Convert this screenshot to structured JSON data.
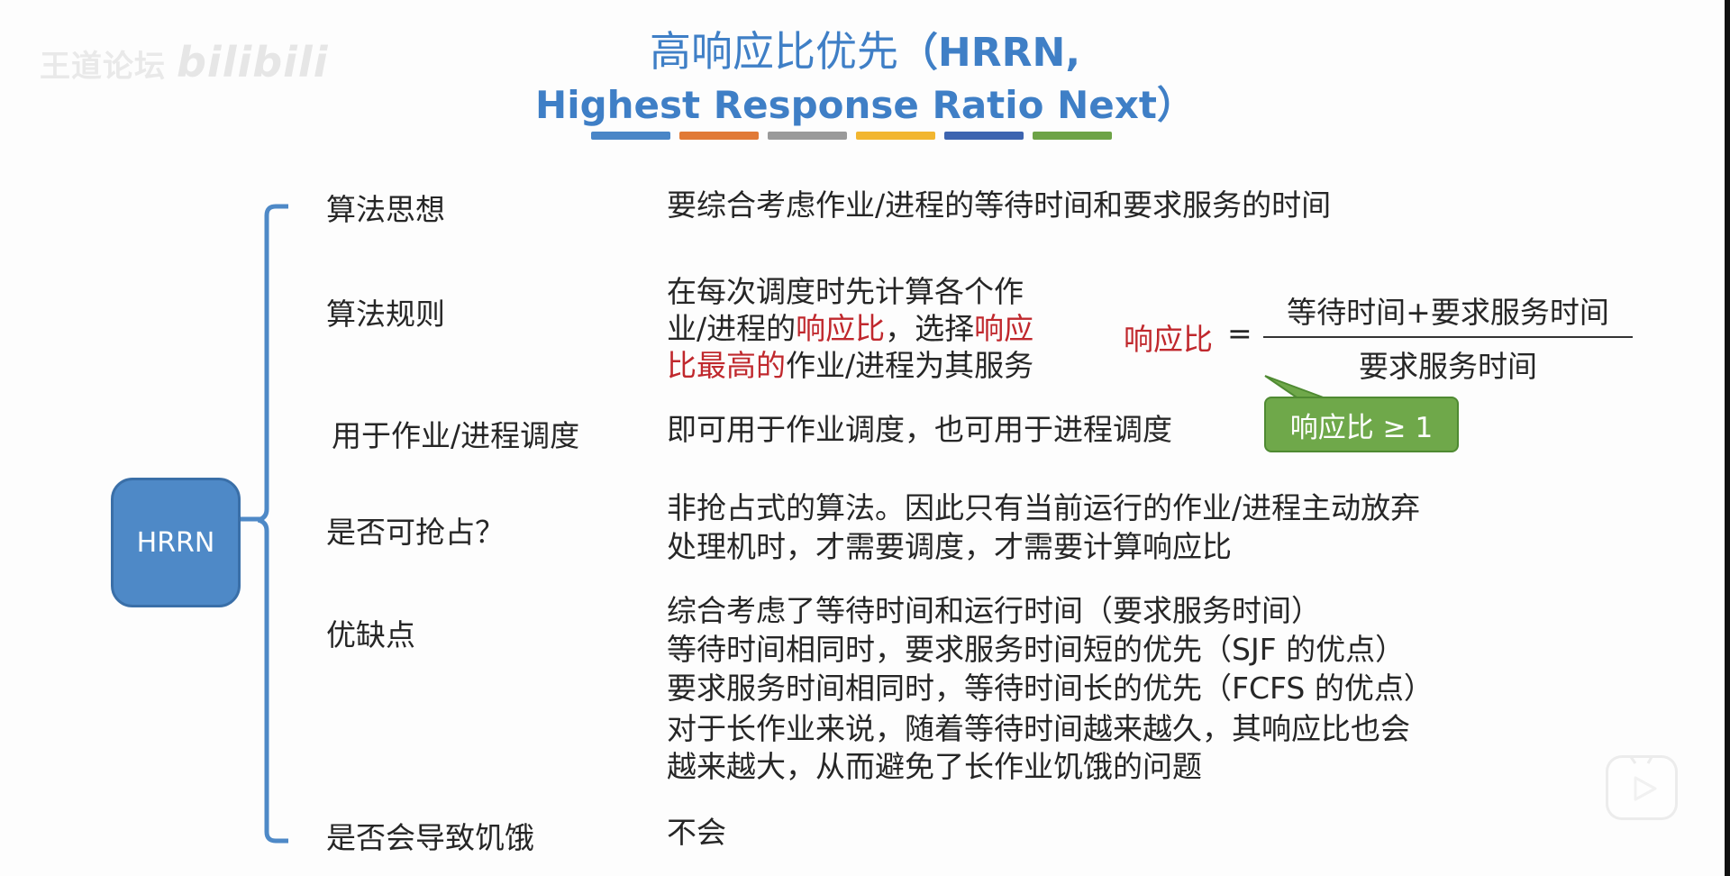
{
  "watermark": {
    "text": "王道论坛",
    "logo": "bilibili"
  },
  "title": {
    "line1_cn": "高响应比优先",
    "line1_en": "（HRRN,",
    "line2": "Highest Response Ratio Next）"
  },
  "title_bar_colors": [
    "#4a86c7",
    "#e17a36",
    "#9a9a9a",
    "#f2b630",
    "#3d64b0",
    "#6da346"
  ],
  "center_node": {
    "label": "HRRN"
  },
  "rows": [
    {
      "label": "算法思想",
      "lines": [
        "要综合考虑作业/进程的等待时间和要求服务的时间"
      ]
    },
    {
      "label": "算法规则",
      "line1": "在每次调度时先计算各个作",
      "line2_a": "业/进程的",
      "line2_b": "响应比",
      "line2_c": "，选择",
      "line2_d": "响应",
      "line3_a": "比最高的",
      "line3_b": "作业/进程为其服务"
    },
    {
      "label": "用于作业/进程调度",
      "lines": [
        "即可用于作业调度，也可用于进程调度"
      ]
    },
    {
      "label": "是否可抢占？",
      "lines": [
        "非抢占式的算法。因此只有当前运行的作业/进程主动放弃",
        "处理机时，才需要调度，才需要计算响应比"
      ]
    },
    {
      "label": "优缺点",
      "lines": [
        "综合考虑了等待时间和运行时间（要求服务时间）",
        "等待时间相同时，要求服务时间短的优先（SJF 的优点）",
        "要求服务时间相同时，等待时间长的优先（FCFS 的优点）",
        "对于长作业来说，随着等待时间越来越久，其响应比也会",
        "越来越大，从而避免了长作业饥饿的问题"
      ]
    },
    {
      "label": "是否会导致饥饿",
      "lines": [
        "不会"
      ]
    }
  ],
  "formula": {
    "lhs": "响应比",
    "eq": "=",
    "numerator": "等待时间+要求服务时间",
    "denominator": "要求服务时间",
    "callout": "响应比 ≥ 1"
  },
  "colors": {
    "title": "#3f7fc6",
    "accent_red": "#c0282d",
    "node_blue": "#4e89c7",
    "callout_green": "#6fa84a"
  },
  "icons": {
    "play": "play-icon"
  }
}
